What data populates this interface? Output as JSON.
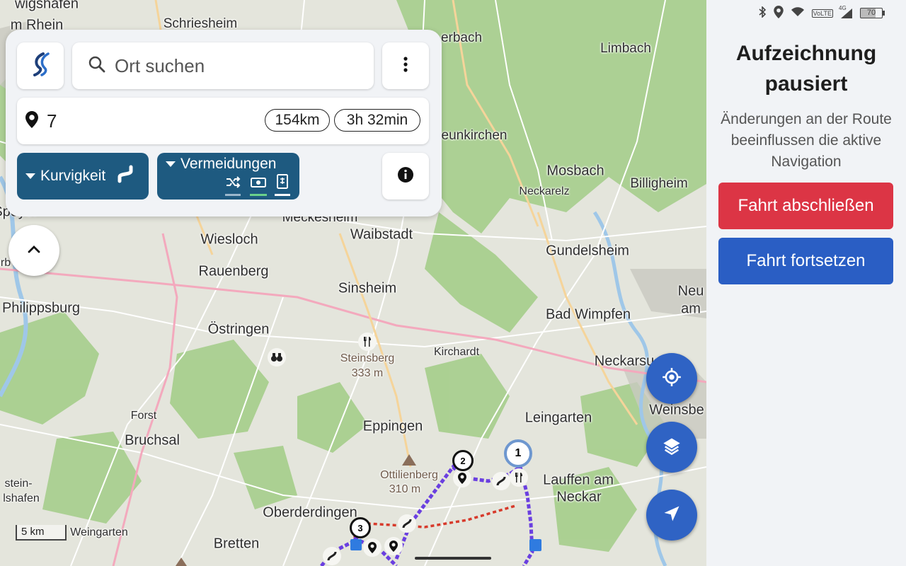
{
  "search": {
    "placeholder": "Ort suchen"
  },
  "route": {
    "waypoints": "7",
    "distance": "154km",
    "duration": "3h 32min"
  },
  "buttons": {
    "curviness": "Kurvigkeit",
    "avoidances": "Vermeidungen"
  },
  "icons": {
    "logo": "logo-icon",
    "search": "search-icon",
    "menu": "more-vert-icon",
    "pin": "pin-icon",
    "curve": "curvy-road-icon",
    "info": "info-icon",
    "shuffle": "shuffle-icon",
    "toll": "toll-icon",
    "ferry": "ferry-icon",
    "collapse": "chevron-up-icon",
    "locate": "my-location-icon",
    "layers": "layers-icon",
    "navigate": "navigation-arrow-icon"
  },
  "map": {
    "scale": "5 km",
    "places": [
      "wigshafen",
      "m Rhein",
      "Schriesheim",
      "erbach",
      "Limbach",
      "eunkirchen",
      "Mosbach",
      "Neckarelz",
      "Billigheim",
      "Speyer",
      "Meckesheim",
      "Waibstadt",
      "Wiesloch",
      "Gundelsheim",
      "Rauenberg",
      "Sinsheim",
      "Neu",
      "am",
      "Philippsburg",
      "Bad Wimpfen",
      "Östringen",
      "Steinsberg",
      "333 m",
      "Kirchardt",
      "Neckarsu",
      "Weinsbe",
      "Forst",
      "Bruchsal",
      "Leingarten",
      "Eppingen",
      "Ottilienberg",
      "310 m",
      "Lauffen am",
      "Neckar",
      "stein-",
      "lshafen",
      "Oberderdingen",
      "Weingarten",
      "Bretten",
      "rb"
    ],
    "waypoints": [
      "1",
      "2",
      "3"
    ]
  },
  "sidebar": {
    "title": "Aufzeichnung pausiert",
    "description": "Änderungen an der Route beeinflussen die aktive Navigation",
    "finish": "Fahrt abschließen",
    "resume": "Fahrt fortsetzen"
  },
  "statusbar": {
    "battery": "70",
    "network": "4G",
    "volte": "VoLTE"
  },
  "colors": {
    "primary": "#2f63c4",
    "panel_button": "#1e5a80",
    "finish": "#dc3545",
    "resume": "#2a5ec4",
    "route": "#6a3fe0"
  }
}
